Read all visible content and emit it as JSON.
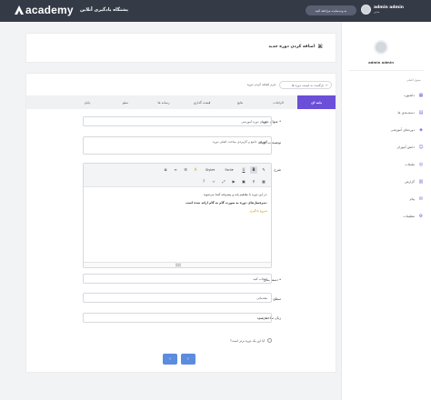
{
  "topbar": {
    "logo_text": "academy",
    "site_title": "پشتگاه یادگیری آنلاین",
    "pill_label": "به وب‌سایت مراجعه کنید",
    "user_name": "admin admin",
    "user_role": "مدیر"
  },
  "sidebar": {
    "profile_name": "admin admin",
    "section_title": "منوی اصلی",
    "items": [
      {
        "label": "داشبورد",
        "icon": "dashboard-icon"
      },
      {
        "label": "دسته‌بندی ها",
        "icon": "category-icon"
      },
      {
        "label": "دوره‌های آموزشی",
        "icon": "course-icon"
      },
      {
        "label": "دانش آموزان",
        "icon": "students-icon"
      },
      {
        "label": "تبلیغات",
        "icon": "ads-icon"
      },
      {
        "label": "گزارش",
        "icon": "report-icon"
      },
      {
        "label": "پیام",
        "icon": "message-icon"
      },
      {
        "label": "تنظیمات",
        "icon": "settings-icon"
      }
    ]
  },
  "header": {
    "title": "اضافه کردن دوره جدید"
  },
  "crumb": {
    "label": "فرم اضافه کردن دوره",
    "search": "بازگشت به لیست دوره ها"
  },
  "tabs": [
    {
      "label": "پایه ای",
      "active": true
    },
    {
      "label": "الزامات"
    },
    {
      "label": "نتایج"
    },
    {
      "label": "قیمت گذاری"
    },
    {
      "label": "رسانه ها"
    },
    {
      "label": "سئو"
    },
    {
      "label": "پایان"
    }
  ],
  "form": {
    "title_label": "عنوان دوره *",
    "title_value": "عنوان دوره آموزشی",
    "short_desc_label": "توضیحات کوتاه",
    "short_desc_value": "آموزش جامع و کاربردی مباحث اصلی دوره",
    "desc_label": "شرح",
    "editor_lines": [
      "در این دوره با مفاهیم پایه و پیشرفته آشنا می‌شوید.",
      "سرفصل‌های دوره به صورت گام به گام ارائه شده است.",
      "شروع یادگیری"
    ],
    "category_label": "دسته بندی *",
    "category_value": "انتخاب کنید",
    "level_label": "سطح",
    "level_value": "مقدماتی",
    "language_label": "زبان ساخته شده",
    "language_value": "فارسی",
    "top_course_label": "آیا این یک دوره برتر است؟",
    "toolbar_style": "Style",
    "toolbar_font": "Font"
  },
  "buttons": {
    "next": "›",
    "prev": "‹"
  },
  "colors": {
    "accent": "#6b4fd8",
    "button": "#5b8ce0",
    "topbar": "#353a47"
  }
}
